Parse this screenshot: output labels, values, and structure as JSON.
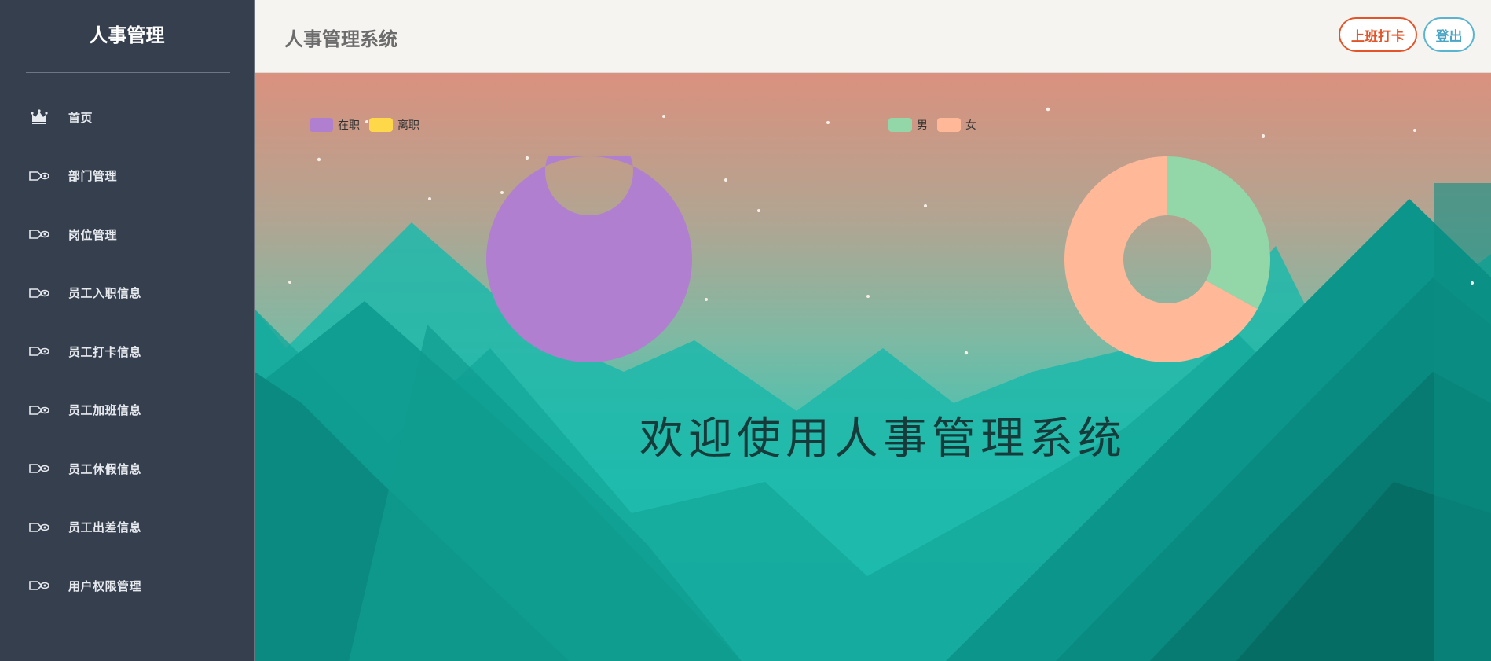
{
  "sidebar": {
    "brand": "人事管理",
    "items": [
      {
        "label": "首页",
        "icon": "crown-icon"
      },
      {
        "label": "部门管理",
        "icon": "arrow-eye-icon"
      },
      {
        "label": "岗位管理",
        "icon": "arrow-eye-icon"
      },
      {
        "label": "员工入职信息",
        "icon": "arrow-eye-icon"
      },
      {
        "label": "员工打卡信息",
        "icon": "arrow-eye-icon"
      },
      {
        "label": "员工加班信息",
        "icon": "arrow-eye-icon"
      },
      {
        "label": "员工休假信息",
        "icon": "arrow-eye-icon"
      },
      {
        "label": "员工出差信息",
        "icon": "arrow-eye-icon"
      },
      {
        "label": "用户权限管理",
        "icon": "arrow-eye-icon"
      }
    ]
  },
  "header": {
    "title": "人事管理系统",
    "clock_in_label": "上班打卡",
    "logout_label": "登出"
  },
  "main": {
    "welcome": "欢迎使用人事管理系统"
  },
  "colors": {
    "accent_orange": "#e2552a",
    "accent_blue": "#5bb4cf",
    "sidebar_bg": "#353f4e"
  },
  "chart_data": [
    {
      "type": "pie",
      "variant": "donut",
      "legend": [
        "在职",
        "离职"
      ],
      "series": [
        {
          "name": "在职",
          "value": 100,
          "color": "#b07fcf"
        },
        {
          "name": "离职",
          "value": 0,
          "color": "#ffd84a"
        }
      ]
    },
    {
      "type": "pie",
      "variant": "donut",
      "legend": [
        "男",
        "女"
      ],
      "series": [
        {
          "name": "男",
          "value": 33,
          "color": "#93d6a8"
        },
        {
          "name": "女",
          "value": 67,
          "color": "#ffb999"
        }
      ]
    }
  ]
}
